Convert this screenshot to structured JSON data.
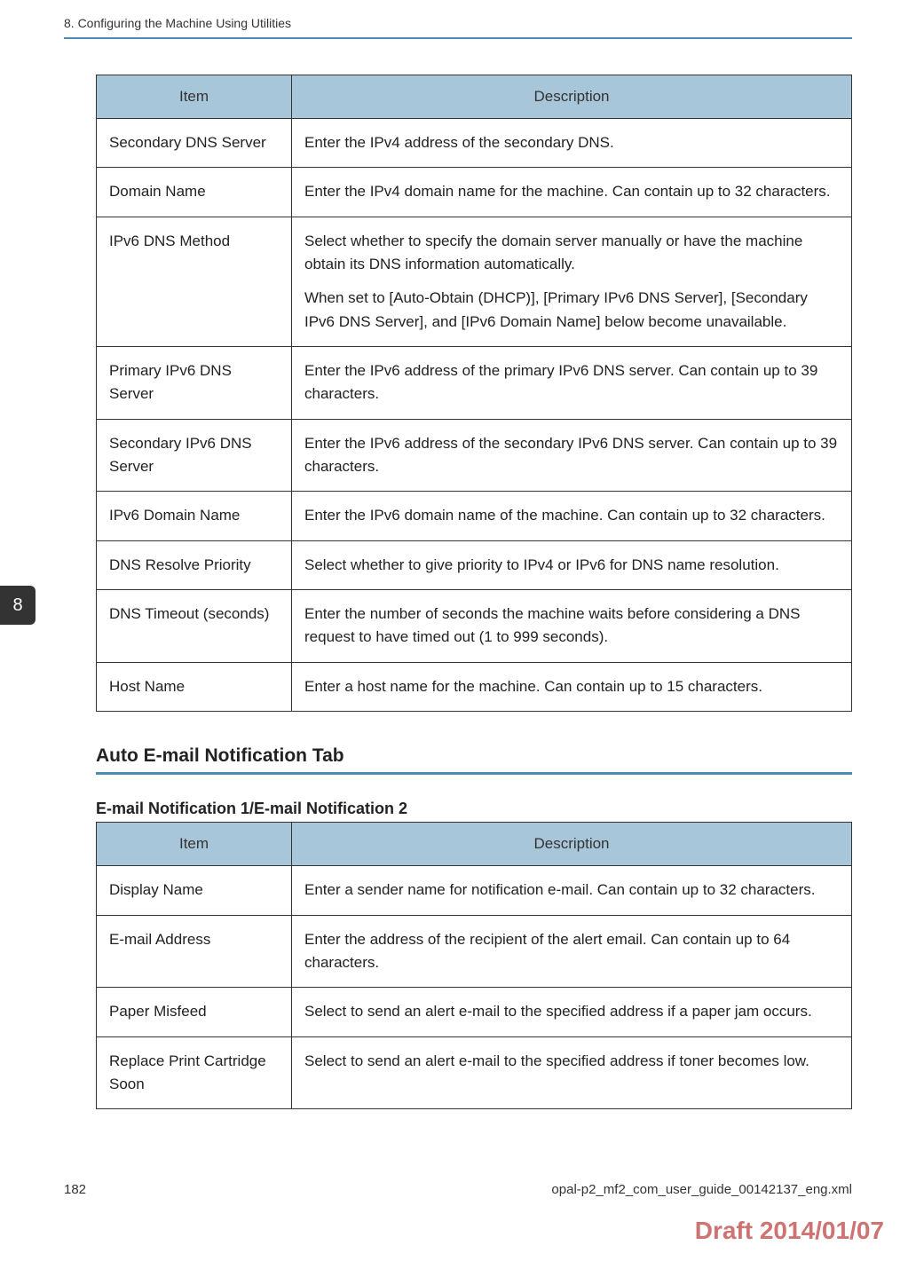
{
  "header": {
    "chapter_title": "8. Configuring the Machine Using Utilities"
  },
  "chapter_tab": "8",
  "table1": {
    "headers": {
      "item": "Item",
      "description": "Description"
    },
    "rows": [
      {
        "item": "Secondary DNS Server",
        "desc": [
          "Enter the IPv4 address of the secondary DNS."
        ]
      },
      {
        "item": "Domain Name",
        "desc": [
          "Enter the IPv4 domain name for the machine. Can contain up to 32 characters."
        ]
      },
      {
        "item": "IPv6 DNS Method",
        "desc": [
          "Select whether to specify the domain server manually or have the machine obtain its DNS information automatically.",
          "When set to [Auto-Obtain (DHCP)], [Primary IPv6 DNS Server], [Secondary IPv6 DNS Server], and [IPv6 Domain Name] below become unavailable."
        ]
      },
      {
        "item": "Primary IPv6 DNS Server",
        "desc": [
          "Enter the IPv6 address of the primary IPv6 DNS server. Can contain up to 39 characters."
        ]
      },
      {
        "item": "Secondary IPv6 DNS Server",
        "desc": [
          "Enter the IPv6 address of the secondary IPv6 DNS server. Can contain up to 39 characters."
        ]
      },
      {
        "item": "IPv6 Domain Name",
        "desc": [
          "Enter the IPv6 domain name of the machine. Can contain up to 32 characters."
        ]
      },
      {
        "item": "DNS Resolve Priority",
        "desc": [
          "Select whether to give priority to IPv4 or IPv6 for DNS name resolution."
        ]
      },
      {
        "item": "DNS Timeout (seconds)",
        "desc": [
          "Enter the number of seconds the machine waits before considering a DNS request to have timed out (1 to 999 seconds)."
        ]
      },
      {
        "item": "Host Name",
        "desc": [
          "Enter a host name for the machine. Can contain up to 15 characters."
        ]
      }
    ]
  },
  "section_heading": "Auto E-mail Notification Tab",
  "subsection_heading": "E-mail Notification 1/E-mail Notification 2",
  "table2": {
    "headers": {
      "item": "Item",
      "description": "Description"
    },
    "rows": [
      {
        "item": "Display Name",
        "desc": [
          "Enter a sender name for notification e-mail. Can contain up to 32 characters."
        ]
      },
      {
        "item": "E-mail Address",
        "desc": [
          "Enter the address of the recipient of the alert email. Can contain up to 64 characters."
        ]
      },
      {
        "item": "Paper Misfeed",
        "desc": [
          "Select to send an alert e-mail to the specified address if a paper jam occurs."
        ]
      },
      {
        "item": "Replace Print Cartridge Soon",
        "desc": [
          "Select to send an alert e-mail to the specified address if toner becomes low."
        ]
      }
    ]
  },
  "footer": {
    "page_number": "182",
    "file_ref": "opal-p2_mf2_com_user_guide_00142137_eng.xml"
  },
  "watermark": "Draft 2014/01/07"
}
